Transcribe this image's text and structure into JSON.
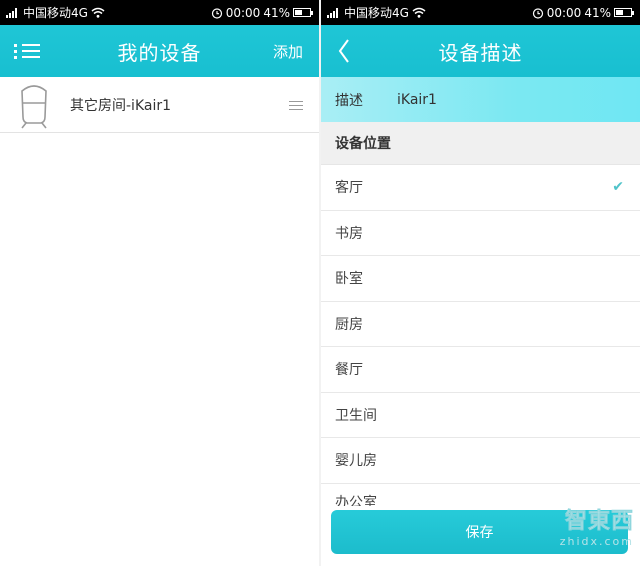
{
  "status_bar": {
    "carrier": "中国移动4G",
    "time": "00:00",
    "battery_percent": "41%"
  },
  "left": {
    "header": {
      "title": "我的设备",
      "add_label": "添加"
    },
    "devices": [
      {
        "name": "其它房间-iKair1",
        "icon": "robot-icon"
      }
    ]
  },
  "right": {
    "header": {
      "title": "设备描述",
      "back_icon": "chevron-left-icon"
    },
    "description": {
      "label": "描述",
      "value": "iKair1"
    },
    "location_section": "设备位置",
    "locations": [
      {
        "label": "客厅",
        "selected": true
      },
      {
        "label": "书房",
        "selected": false
      },
      {
        "label": "卧室",
        "selected": false
      },
      {
        "label": "厨房",
        "selected": false
      },
      {
        "label": "餐厅",
        "selected": false
      },
      {
        "label": "卫生间",
        "selected": false
      },
      {
        "label": "婴儿房",
        "selected": false
      },
      {
        "label": "办公室",
        "selected": false
      }
    ],
    "check_mark": "✔",
    "save_label": "保存"
  },
  "watermark": {
    "logo": "智東西",
    "url": "zhidx.com"
  },
  "colors": {
    "accent": "#1fc6d6",
    "desc_bg": "#7be8f2",
    "check": "#4fc3c9"
  }
}
